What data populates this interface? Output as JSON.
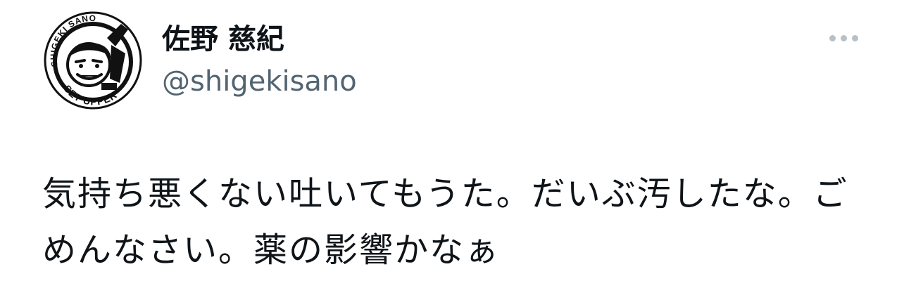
{
  "author": {
    "display_name": "佐野 慈紀",
    "handle": "@shigekisano",
    "avatar": {
      "icon": "cartoon-face-logo-icon",
      "logo_text_top": "SHIGEKI SANO",
      "logo_text_bottom": "SET UPPER"
    }
  },
  "tweet": {
    "text": "気持ち悪くない吐いてもうた。だいぶ汚したな。ごめんなさい。薬の影響かなぁ"
  },
  "menu": {
    "icon": "more-horizontal-icon"
  },
  "colors": {
    "text_primary": "#0f1419",
    "text_secondary": "#536471",
    "dots": "#b7c0c7"
  }
}
